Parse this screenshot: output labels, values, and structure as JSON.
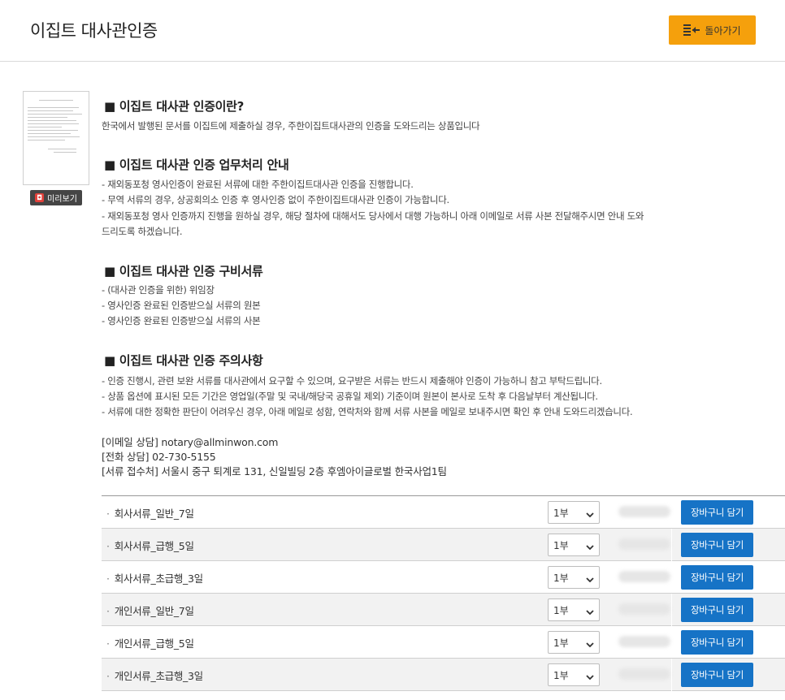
{
  "header": {
    "title": "이집트 대사관인증",
    "back_label": "돌아가기"
  },
  "preview": {
    "label": "미리보기"
  },
  "sections": {
    "s1_title": "■ 이집트 대사관 인증이란?",
    "s1_line1": "한국에서 발행된 문서를 이집트에 제출하실 경우, 주한이집트대사관의 인증을 도와드리는 상품입니다",
    "s2_title": "■ 이집트 대사관 인증 업무처리 안내",
    "s2_line1": "- 재외동포청 영사인증이 완료된 서류에 대한 주한이집트대사관 인증을 진행합니다.",
    "s2_line2": "- 무역 서류의 경우, 상공회의소 인증 후 영사인증 없이 주한이집트대사관 인증이 가능합니다.",
    "s2_line3": "- 재외동포청 영사 인증까지 진행을 원하실 경우, 해당 절차에 대해서도 당사에서 대행 가능하니 아래 이메일로 서류 사본 전달해주시면 안내 도와",
    "s2_line4": "드리도록 하겠습니다.",
    "s3_title": "■ 이집트 대사관 인증 구비서류",
    "s3_line1": "- (대사관 인증을 위한) 위임장",
    "s3_line2": "- 영사인증 완료된 인증받으실 서류의 원본",
    "s3_line3": "- 영사인증 완료된 인증받으실 서류의 사본",
    "s4_title": "■ 이집트 대사관 인증 주의사항",
    "s4_line1": "- 인증 진행시, 관련 보완 서류를 대사관에서 요구할 수 있으며, 요구받은 서류는 반드시 제출해야 인증이 가능하니 참고 부탁드립니다.",
    "s4_line2": "- 상품 옵션에 표시된 모든 기간은 영업일(주말 및 국내/해당국 공휴일 제외) 기준이며 원본이 본사로 도착 후 다음날부터 계산됩니다.",
    "s4_line3": "- 서류에 대한 정확한 판단이 어려우신 경우, 아래 메일로 성함, 연락처와 함께 서류 사본을 메일로 보내주시면 확인 후 안내 도와드리겠습니다."
  },
  "contact": {
    "email": "[이메일 상담] notary@allminwon.com",
    "phone": "[전화 상담] 02-730-5155",
    "address": "[서류 접수처] 서울시 중구 퇴계로 131, 신일빌딩 2층 후엠아이글로벌 한국사업1팀"
  },
  "products": [
    {
      "name": "회사서류_일반_7일",
      "qty": "1부",
      "cart_label": "장바구니 담기"
    },
    {
      "name": "회사서류_급행_5일",
      "qty": "1부",
      "cart_label": "장바구니 담기"
    },
    {
      "name": "회사서류_초급행_3일",
      "qty": "1부",
      "cart_label": "장바구니 담기"
    },
    {
      "name": "개인서류_일반_7일",
      "qty": "1부",
      "cart_label": "장바구니 담기"
    },
    {
      "name": "개인서류_급행_5일",
      "qty": "1부",
      "cart_label": "장바구니 담기"
    },
    {
      "name": "개인서류_초급행_3일",
      "qty": "1부",
      "cart_label": "장바구니 담기"
    }
  ],
  "bullet": "·",
  "colors": {
    "accent": "#f5a00c",
    "cart": "#1673c6",
    "preview_icon": "#e2403a"
  },
  "icons": {
    "back": "list-back-icon",
    "preview": "pdf-icon",
    "select": "chevron-down-icon"
  }
}
